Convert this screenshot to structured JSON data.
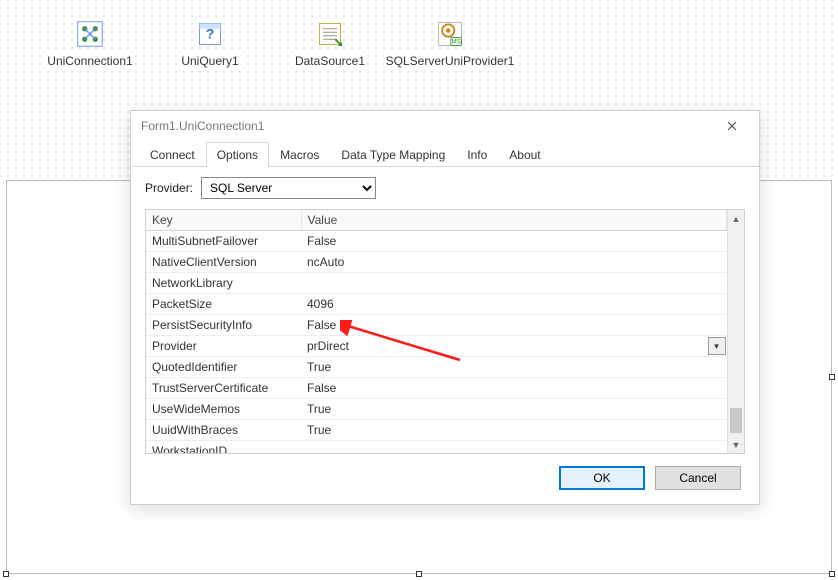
{
  "components": [
    {
      "label": "UniConnection1",
      "icon": "uniconnection-icon"
    },
    {
      "label": "UniQuery1",
      "icon": "uniquery-icon"
    },
    {
      "label": "DataSource1",
      "icon": "datasource-icon"
    },
    {
      "label": "SQLServerUniProvider1",
      "icon": "sqlserverprovider-icon"
    }
  ],
  "dialog": {
    "title": "Form1.UniConnection1",
    "tabs": [
      "Connect",
      "Options",
      "Macros",
      "Data Type Mapping",
      "Info",
      "About"
    ],
    "active_tab": "Options",
    "provider_label": "Provider:",
    "provider_value": "SQL Server",
    "grid_headers": {
      "key": "Key",
      "value": "Value"
    },
    "rows": [
      {
        "key": "MultiSubnetFailover",
        "value": "False"
      },
      {
        "key": "NativeClientVersion",
        "value": "ncAuto"
      },
      {
        "key": "NetworkLibrary",
        "value": ""
      },
      {
        "key": "PacketSize",
        "value": "4096"
      },
      {
        "key": "PersistSecurityInfo",
        "value": "False"
      },
      {
        "key": "Provider",
        "value": "prDirect",
        "selected": true
      },
      {
        "key": "QuotedIdentifier",
        "value": "True"
      },
      {
        "key": "TrustServerCertificate",
        "value": "False"
      },
      {
        "key": "UseWideMemos",
        "value": "True"
      },
      {
        "key": "UuidWithBraces",
        "value": "True"
      },
      {
        "key": "WorkstationID",
        "value": ""
      }
    ],
    "buttons": {
      "ok": "OK",
      "cancel": "Cancel"
    }
  }
}
